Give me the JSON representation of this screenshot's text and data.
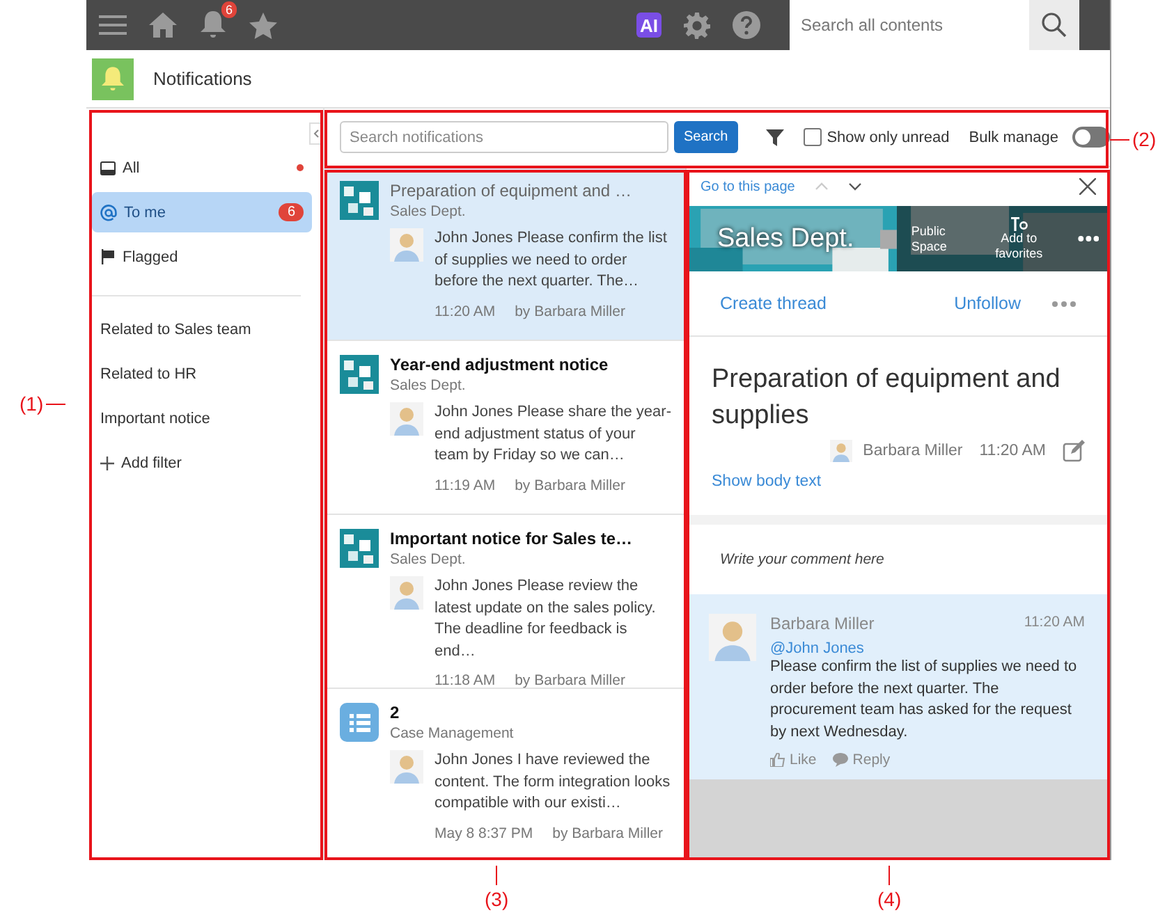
{
  "topbar": {
    "notification_count": "6",
    "ai_label": "AI",
    "search": {
      "placeholder": "Search all contents"
    }
  },
  "app_header": {
    "title": "Notifications"
  },
  "sidebar": {
    "folders": [
      {
        "kind": "inbox",
        "label": "All",
        "selected": false,
        "unread": true
      },
      {
        "kind": "mention",
        "label": "To me",
        "selected": true,
        "unread": false,
        "badge": "6"
      },
      {
        "kind": "flag",
        "label": "Flagged",
        "selected": false,
        "unread": false
      }
    ],
    "filters": [
      {
        "label": "Related to Sales team"
      },
      {
        "label": "Related to HR"
      },
      {
        "label": "Important notice"
      }
    ],
    "add_filter": "Add filter"
  },
  "toolbar": {
    "search": {
      "placeholder": "Search notifications"
    },
    "search_button": "Search",
    "show_only_unread": {
      "label": "Show only unread",
      "checked": false
    },
    "bulk_manage": {
      "label": "Bulk manage",
      "on": false
    }
  },
  "notifications": [
    {
      "kind": "space",
      "title": "Preparation of equipment and …",
      "unread": false,
      "selected": true,
      "source": "Sales Dept.",
      "body": "John Jones Please confirm the list of supplies we need to order before the next quarter. The…",
      "time": "11:20 AM",
      "author": "by Barbara Miller"
    },
    {
      "kind": "space",
      "title": "Year-end adjustment notice",
      "unread": true,
      "selected": false,
      "source": "Sales Dept.",
      "body": "John Jones Please share the year-end adjustment status of your team by Friday so we can…",
      "time": "11:19 AM",
      "author": "by Barbara Miller"
    },
    {
      "kind": "space",
      "title": "Important notice for Sales te…",
      "unread": true,
      "selected": false,
      "source": "Sales Dept.",
      "body": "John Jones Please review the latest update on the sales policy. The deadline for feedback is end…",
      "time": "11:18 AM",
      "author": "by Barbara Miller"
    },
    {
      "kind": "app",
      "title": "2",
      "unread": true,
      "selected": false,
      "source": "Case Management",
      "body": "John Jones I have reviewed the content. The form integration looks compatible with our existi…",
      "time": "May 8 8:37 PM",
      "author": "by Barbara Miller"
    }
  ],
  "detail": {
    "go_to_page": "Go to this page",
    "space": {
      "name": "Sales Dept.",
      "public_label": "Public Space",
      "favorite_label": "Add to favorites"
    },
    "create_thread": "Create thread",
    "unfollow": "Unfollow",
    "post": {
      "title": "Preparation of equipment and supplies",
      "author": "Barbara Miller",
      "time": "11:20 AM",
      "show_body": "Show body text"
    },
    "comment_field": {
      "placeholder": "Write your comment here"
    },
    "comment": {
      "author": "Barbara Miller",
      "time": "11:20 AM",
      "mention": "@John Jones",
      "text": " Please confirm the list of supplies we need to order before the next quarter. The procurement team has asked for the request by next Wednesday.",
      "like": "Like",
      "reply": "Reply"
    }
  },
  "annotations": [
    {
      "label": "(1)"
    },
    {
      "label": "(2)"
    },
    {
      "label": "(3)"
    },
    {
      "label": "(4)"
    }
  ]
}
